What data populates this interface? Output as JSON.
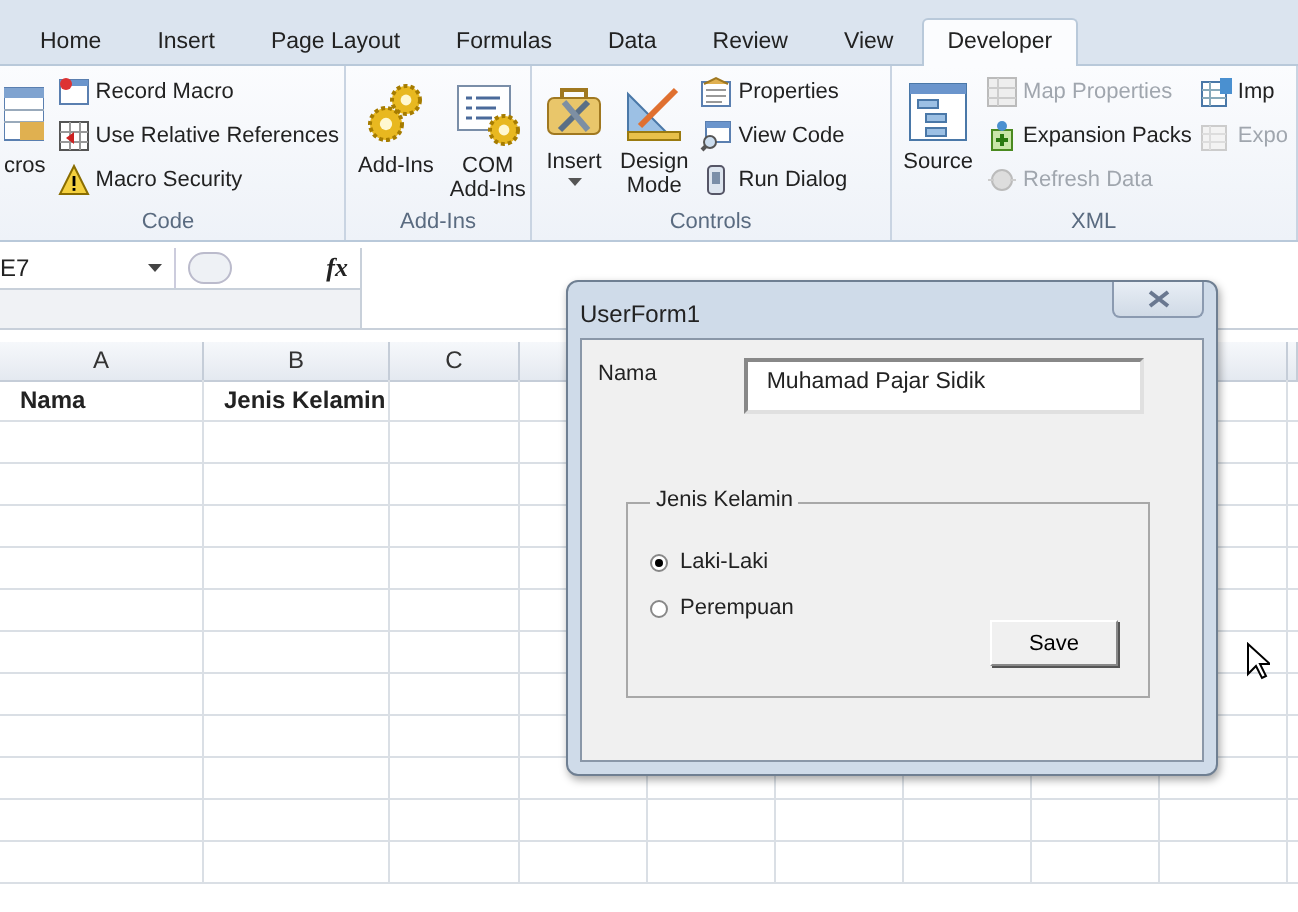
{
  "ribbon": {
    "tabs": [
      {
        "label": "Home",
        "selected": false
      },
      {
        "label": "Insert",
        "selected": false
      },
      {
        "label": "Page Layout",
        "selected": false
      },
      {
        "label": "Formulas",
        "selected": false
      },
      {
        "label": "Data",
        "selected": false
      },
      {
        "label": "Review",
        "selected": false
      },
      {
        "label": "View",
        "selected": false
      },
      {
        "label": "Developer",
        "selected": true
      }
    ],
    "groups": [
      {
        "label": "Code",
        "items": [
          {
            "kind": "large",
            "label": "cros",
            "disabled": false
          },
          {
            "kind": "small",
            "label": "Record Macro",
            "disabled": false
          },
          {
            "kind": "small",
            "label": "Use Relative References",
            "disabled": false
          },
          {
            "kind": "small",
            "label": "Macro Security",
            "disabled": false
          }
        ]
      },
      {
        "label": "Add-Ins",
        "items": [
          {
            "kind": "large",
            "label": "Add-Ins",
            "disabled": false
          },
          {
            "kind": "large",
            "label": "COM\nAdd-Ins",
            "disabled": false
          }
        ]
      },
      {
        "label": "Controls",
        "items": [
          {
            "kind": "dropdown",
            "label": "Insert",
            "disabled": false
          },
          {
            "kind": "large",
            "label": "Design\nMode",
            "disabled": false
          },
          {
            "kind": "small",
            "label": "Properties",
            "disabled": false
          },
          {
            "kind": "small",
            "label": "View Code",
            "disabled": false
          },
          {
            "kind": "small",
            "label": "Run Dialog",
            "disabled": false
          }
        ]
      },
      {
        "label": "XML",
        "items": [
          {
            "kind": "large",
            "label": "Source",
            "disabled": false
          },
          {
            "kind": "small",
            "label": "Map Properties",
            "disabled": true
          },
          {
            "kind": "small",
            "label": "Expansion Packs",
            "disabled": false
          },
          {
            "kind": "small",
            "label": "Refresh Data",
            "disabled": true
          },
          {
            "kind": "small",
            "label": "Imp",
            "disabled": false
          },
          {
            "kind": "small",
            "label": "Expo",
            "disabled": true
          }
        ]
      }
    ]
  },
  "formula_bar": {
    "name_box": "E7",
    "function_button": "fx"
  },
  "sheet": {
    "columns": [
      "A",
      "B",
      "C"
    ],
    "rows": [
      [
        "Nama",
        "Jenis Kelamin"
      ]
    ]
  },
  "dialog": {
    "title": "UserForm1",
    "name_label": "Nama",
    "name_value": "Muhamad Pajar Sidik",
    "frame_label": "Jenis Kelamin",
    "options": [
      {
        "label": "Laki-Laki",
        "selected": true
      },
      {
        "label": "Perempuan",
        "selected": false
      }
    ],
    "button": "Save"
  }
}
